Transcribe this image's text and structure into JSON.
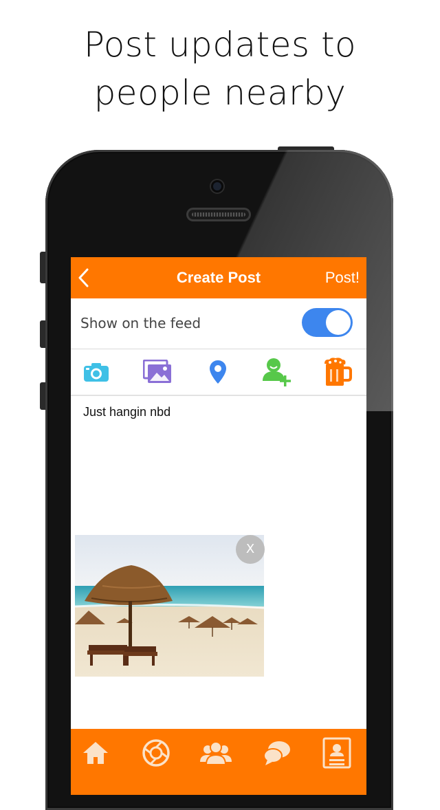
{
  "promo": {
    "line1": "Post updates to",
    "line2": "people nearby"
  },
  "nav": {
    "title": "Create Post",
    "post_label": "Post!",
    "back_icon": "chevron-left-icon"
  },
  "settings": {
    "show_on_feed_label": "Show on the feed",
    "show_on_feed_enabled": true
  },
  "attach_icons": [
    "camera-icon",
    "gallery-icon",
    "location-pin-icon",
    "tag-friend-icon",
    "beer-icon"
  ],
  "post": {
    "text": "Just hangin nbd",
    "remove_photo_label": "X"
  },
  "tabbar": {
    "items": [
      "home-icon",
      "camera-shutter-icon",
      "people-icon",
      "chat-icon",
      "profile-card-icon"
    ]
  },
  "colors": {
    "accent": "#ff7700",
    "toggle_on": "#3d86ee",
    "camera_icon": "#3fc0e6",
    "gallery_icon": "#8a6fd6",
    "pin_icon": "#3d86ee",
    "tag_friend_icon": "#57c84a",
    "beer_icon": "#ff7700"
  }
}
